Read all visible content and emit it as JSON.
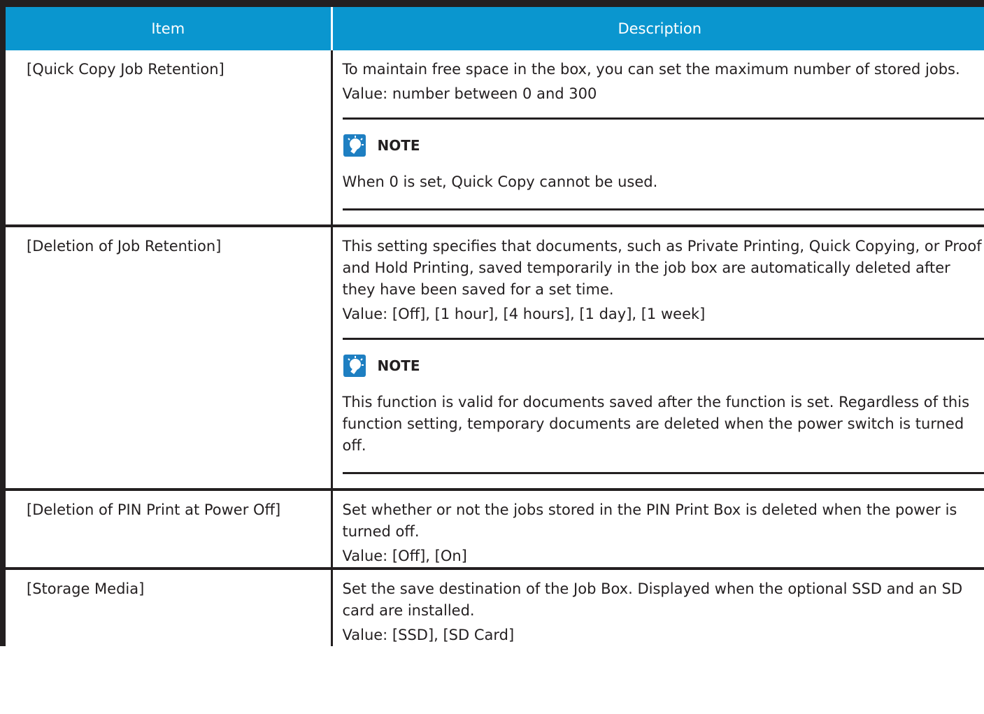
{
  "table": {
    "headers": {
      "item": "Item",
      "description": "Description"
    },
    "rows": [
      {
        "item": "[Quick Copy Job Retention]",
        "paragraphs": [
          "To maintain free space in the box, you can set the maximum number of stored jobs.",
          "Value: number between 0 and 300"
        ],
        "note": {
          "title": "NOTE",
          "lines": [
            "When 0 is set, Quick Copy cannot be used."
          ]
        }
      },
      {
        "item": "[Deletion of Job Retention]",
        "paragraphs": [
          "This setting specifies that documents, such as Private Printing, Quick Copying, or Proof and Hold Printing, saved temporarily in the job box are automatically deleted after they have been saved for a set time.",
          "Value: [Off], [1 hour], [4 hours], [1 day], [1 week]"
        ],
        "note": {
          "title": "NOTE",
          "lines": [
            "This function is valid for documents saved after the function is set. Regardless of this function setting, temporary documents are deleted when the power switch is turned off."
          ]
        }
      },
      {
        "item": "[Deletion of PIN Print at Power Off]",
        "paragraphs": [
          "Set whether or not the jobs stored in the PIN Print Box is deleted when the power is turned off.",
          "Value: [Off], [On]"
        ]
      },
      {
        "item": "[Storage Media]",
        "paragraphs": [
          "Set the save destination of the Job Box. Displayed when the optional SSD and an SD card are installed.",
          "Value: [SSD], [SD Card]"
        ]
      }
    ]
  },
  "colors": {
    "header_bg": "#0a96cf",
    "rule": "#231f20",
    "note_icon_bg": "#1e7fc2"
  },
  "icons": {
    "note": "lightbulb-note-icon"
  }
}
